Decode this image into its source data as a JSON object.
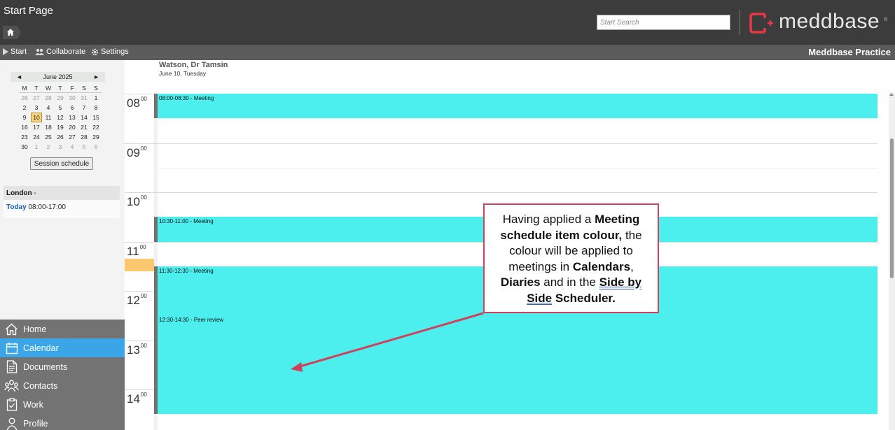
{
  "header": {
    "page_title": "Start Page",
    "search_placeholder": "Start Search",
    "logo_text": "meddbase",
    "logo_reg": "®"
  },
  "toolbar": {
    "start_label": "Start",
    "collaborate_label": "Collaborate",
    "settings_label": "Settings",
    "product_label": "Meddbase Practice"
  },
  "mini_calendar": {
    "month_label": "June 2025",
    "prev": "◄",
    "next": "►",
    "weekdays": [
      "M",
      "T",
      "W",
      "T",
      "F",
      "S",
      "S"
    ],
    "weeks": [
      [
        "26",
        "27",
        "28",
        "29",
        "30",
        "31",
        "1"
      ],
      [
        "2",
        "3",
        "4",
        "5",
        "6",
        "7",
        "8"
      ],
      [
        "9",
        "10",
        "11",
        "12",
        "13",
        "14",
        "15"
      ],
      [
        "16",
        "17",
        "18",
        "19",
        "20",
        "21",
        "22"
      ],
      [
        "23",
        "24",
        "25",
        "26",
        "27",
        "28",
        "29"
      ],
      [
        "30",
        "1",
        "2",
        "3",
        "4",
        "5",
        "6"
      ]
    ],
    "selected_day": "10",
    "session_button": "Session schedule"
  },
  "location": {
    "name": "London",
    "suffix": " -",
    "today_label": "Today",
    "hours": " 08:00-17:00"
  },
  "nav": {
    "items": [
      {
        "label": "Home",
        "icon": "home-icon",
        "active": false
      },
      {
        "label": "Calendar",
        "icon": "calendar-icon",
        "active": true
      },
      {
        "label": "Documents",
        "icon": "document-icon",
        "active": false
      },
      {
        "label": "Contacts",
        "icon": "contacts-icon",
        "active": false
      },
      {
        "label": "Work",
        "icon": "clipboard-icon",
        "active": false
      },
      {
        "label": "Profile",
        "icon": "person-icon",
        "active": false
      }
    ]
  },
  "calendar": {
    "doctor_name": "Watson, Dr Tamsin",
    "date_label": "June 10, Tuesday",
    "hours": [
      {
        "hour": "08",
        "min": "00"
      },
      {
        "hour": "09",
        "min": "00"
      },
      {
        "hour": "10",
        "min": "00"
      },
      {
        "hour": "11",
        "min": "00"
      },
      {
        "hour": "12",
        "min": "00"
      },
      {
        "hour": "13",
        "min": "00"
      },
      {
        "hour": "14",
        "min": "00"
      }
    ],
    "current_hour": "11",
    "events": [
      {
        "label": "08:00-08:30 - Meeting",
        "start": "08:00",
        "end": "08:30"
      },
      {
        "label": "10:30-11:00 - Meeting",
        "start": "10:30",
        "end": "11:00"
      },
      {
        "label": "11:30-12:30 - Meeting",
        "start": "11:30",
        "end": "12:30"
      },
      {
        "label": "12:30-14:30 - Peer review",
        "start": "12:30",
        "end": "14:30"
      }
    ],
    "event_color": "#4ceeee"
  },
  "callout": {
    "t1": "Having applied a ",
    "t2": "Meeting schedule item colour,",
    "t3": " the colour will be applied to meetings in ",
    "t4": "Calendars",
    "t5": ", ",
    "t6": "Diaries",
    "t7": " and in the ",
    "t8": "Side by",
    "t9": " ",
    "t10": "Side",
    "t11": " Scheduler.",
    "border_color": "#d0425c"
  }
}
